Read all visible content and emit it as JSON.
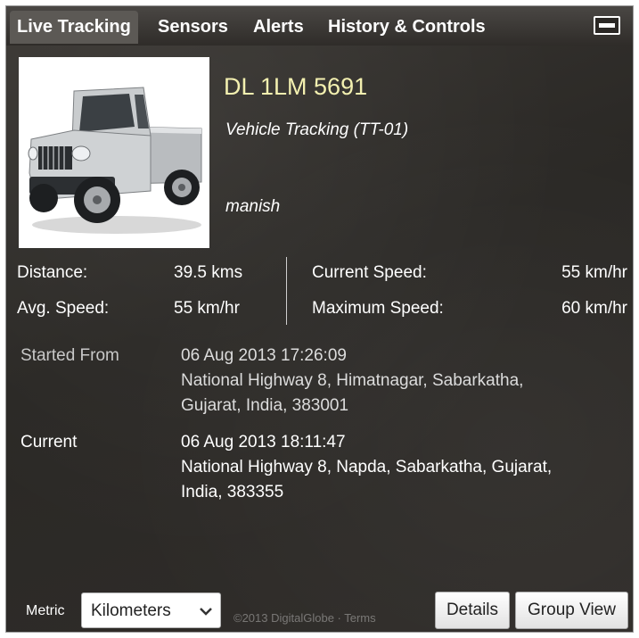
{
  "tabs": [
    {
      "label": "Live Tracking",
      "active": true
    },
    {
      "label": "Sensors",
      "active": false
    },
    {
      "label": "Alerts",
      "active": false
    },
    {
      "label": "History & Controls",
      "active": false
    }
  ],
  "vehicle": {
    "plate": "DL 1LM 5691",
    "subtitle": "Vehicle Tracking (TT-01)",
    "driver": "manish"
  },
  "stats": {
    "distance_label": "Distance:",
    "distance_value": "39.5 kms",
    "avg_speed_label": "Avg. Speed:",
    "avg_speed_value": "55 km/hr",
    "current_speed_label": "Current Speed:",
    "current_speed_value": "55 km/hr",
    "max_speed_label": "Maximum Speed:",
    "max_speed_value": "60 km/hr"
  },
  "start": {
    "label": "Started From",
    "time": "06 Aug 2013 17:26:09",
    "address_line1": "National Highway 8, Himatnagar, Sabarkatha,",
    "address_line2": "Gujarat, India, 383001"
  },
  "current": {
    "label": "Current",
    "time": "06 Aug 2013 18:11:47",
    "address_line1": "National Highway 8, Napda, Sabarkatha, Gujarat,",
    "address_line2": "India, 383355"
  },
  "footer": {
    "metric_label": "Metric",
    "metric_value": "Kilometers",
    "details_label": "Details",
    "group_view_label": "Group View",
    "attribution": "©2013 DigitalGlobe · Terms"
  },
  "colors": {
    "plate": "#f3f0b0",
    "panel_bg": "#2e2b28",
    "tab_active": "#5c5955"
  },
  "icons": {
    "minimize": "minimize-icon",
    "dropdown": "chevron-down-icon"
  }
}
